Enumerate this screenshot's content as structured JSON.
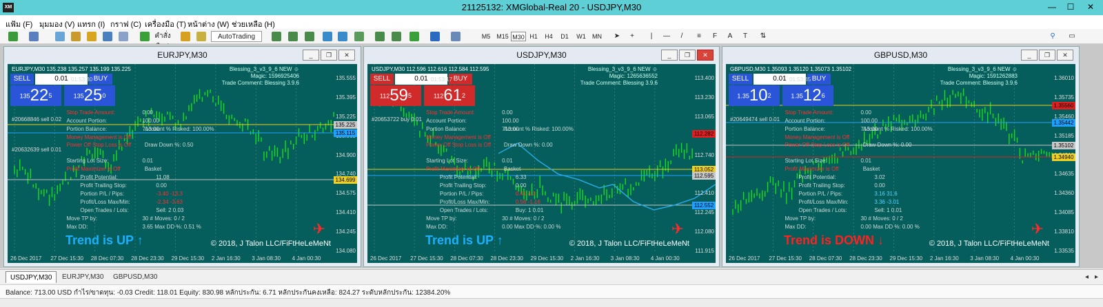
{
  "app": {
    "title": "21125132: XMGlobal-Real 20 - USDJPY,M30",
    "logo": "XM"
  },
  "menu": [
    "แฟ้ม (F)",
    "มุมมอง (V)",
    "แทรก (I)",
    "กราฟ (C)",
    "เครื่องมือ (T)",
    "หน้าต่าง (W)",
    "ช่วยเหลือ (H)"
  ],
  "toolbar": {
    "new_order_label": "คำสั่งใหม่",
    "autotrading_label": "AutoTrading",
    "timeframes": [
      "M5",
      "M15",
      "M30",
      "H1",
      "H4",
      "D1",
      "W1",
      "MN"
    ]
  },
  "charts": [
    {
      "title": "EURJPY,M30",
      "header": "EURJPY,M30  135.238 135.257 135.199 135.225",
      "ea_name": "Blessing_3_v3_9_6 NEW ☺",
      "magic": "Magic: 1596925406",
      "comment": "Trade Comment: Blessing 3.9.6",
      "lot": "0.01",
      "time": "01:53:30",
      "sell_big": "22",
      "sell_small": "135",
      "sell_sup": "5",
      "buy_big": "25",
      "buy_small": "135",
      "buy_sup": "0",
      "sell_label": "SELL",
      "buy_label": "BUY",
      "prices": [
        "135.555",
        "135.395",
        "135.225",
        "135.065",
        "134.900",
        "134.740",
        "134.575",
        "134.410",
        "134.245",
        "134.080"
      ],
      "price_tags": [
        {
          "text": "135.225",
          "color": "#c8c8c8"
        },
        {
          "text": "135.115",
          "color": "#1ea0ff"
        },
        {
          "text": "134.699",
          "color": "#f0d020"
        }
      ],
      "times": [
        "26 Dec 2017",
        "27 Dec 15:30",
        "28 Dec 07:30",
        "28 Dec 23:30",
        "29 Dec 15:30",
        "2 Jan 16:30",
        "3 Jan 08:30",
        "4 Jan 00:30"
      ],
      "order_lines": [
        "#20668846 sell 0.02",
        "#20632639 sell 0.01"
      ],
      "trend_text": "Trend is UP ↑",
      "trend_color": "#18b0ff",
      "copyright": "© 2018, J Talon LLC/FiFtHeLeMeNt",
      "stats": {
        "stop_amount": "0.00",
        "portion": "100.00",
        "account_portion": "100.00",
        "portion_balance": "713.00",
        "account_risked": "100.00%",
        "mm": "Money Management is Off",
        "power_off": "Power Off Stop Loss is Off",
        "drawdown": "0.50",
        "lot_size": "0.01",
        "pm": "Profit Maximizer is Off",
        "basket_label": "Basket",
        "profit_potential": "11.08",
        "trailing_stop": "0.00",
        "pl_pips": "-3.40",
        "pl_pips2": "-13.3",
        "maxmin": "-2.34",
        "maxmin2": "-3.63",
        "open_trades": "Sell:",
        "sell_count": "2",
        "sell_lots": "0.03",
        "move_tp": "30",
        "moves": "0 / 2",
        "max_dd": "3.65",
        "max_dd_pct": "0.51 %"
      }
    },
    {
      "title": "USDJPY,M30",
      "header": "USDJPY,M30  112.596 112.616 112.584 112.595",
      "ea_name": "Blessing_3_v3_9_6 NEW ☺",
      "magic": "Magic: 1265636552",
      "comment": "Trade Comment: Blessing 3.9.6",
      "lot": "0.01",
      "time": "01:53:17",
      "sell_big": "59",
      "sell_small": "112",
      "sell_sup": "5",
      "buy_big": "61",
      "buy_small": "112",
      "buy_sup": "2",
      "sell_label": "SELL",
      "buy_label": "BUY",
      "prices": [
        "113.400",
        "113.230",
        "113.065",
        "112.900",
        "112.740",
        "112.570",
        "112.410",
        "112.245",
        "112.080",
        "111.915"
      ],
      "price_tags": [
        {
          "text": "113.052",
          "color": "#f0d020"
        },
        {
          "text": "112.595",
          "color": "#c8c8c8"
        },
        {
          "text": "112.552",
          "color": "#1ea0ff"
        },
        {
          "text": "112.282",
          "color": "#e02020"
        }
      ],
      "times": [
        "26 Dec 2017",
        "27 Dec 15:30",
        "28 Dec 07:30",
        "28 Dec 23:30",
        "29 Dec 15:30",
        "2 Jan 16:30",
        "3 Jan 08:30",
        "4 Jan 00:30"
      ],
      "order_lines": [
        "#20653722 buy 0.01"
      ],
      "trend_text": "Trend is UP ↑",
      "trend_color": "#18b0ff",
      "copyright": "© 2018, J Talon LLC/FiFtHeLeMeNt",
      "stats": {
        "stop_amount": "0.00",
        "portion": "100.00",
        "account_portion": "100.00",
        "portion_balance": "713.00",
        "account_risked": "100.00%",
        "mm": "Money Management is Off",
        "power_off": "Power Off Stop Loss is Off",
        "drawdown": "0.00",
        "lot_size": "0.01",
        "pm": "Profit Maximizer is Off",
        "basket_label": "Basket",
        "profit_potential": "6.33",
        "trailing_stop": "0.00",
        "pl_pips": "0.41",
        "pl_pips2": "4.3",
        "maxmin": "0.56",
        "maxmin2": "-1.16",
        "open_trades": "Buy:",
        "sell_count": "1",
        "sell_lots": "0.01",
        "move_tp": "30",
        "moves": "0 / 2",
        "max_dd": "0.00",
        "max_dd_pct": "0.00 %"
      }
    },
    {
      "title": "GBPUSD,M30",
      "header": "GBPUSD,M30  1.35093 1.35120 1.35073 1.35102",
      "ea_name": "Blessing_3_v3_9_6 NEW ☺",
      "magic": "Magic: 1591262883",
      "comment": "Trade Comment: Blessing 3.9.6",
      "lot": "0.01",
      "time": "01:53:35",
      "sell_big": "10",
      "sell_small": "1.35",
      "sell_sup": "2",
      "buy_big": "12",
      "buy_small": "1.35",
      "buy_sup": "6",
      "sell_label": "SELL",
      "buy_label": "BUY",
      "prices": [
        "1.36010",
        "1.35735",
        "1.35460",
        "1.35185",
        "1.34910",
        "1.34635",
        "1.34360",
        "1.34085",
        "1.33810",
        "1.33535"
      ],
      "price_tags": [
        {
          "text": "1.35560",
          "color": "#e02020"
        },
        {
          "text": "1.35442",
          "color": "#1ea0ff"
        },
        {
          "text": "1.35102",
          "color": "#c8c8c8"
        },
        {
          "text": "1.34940",
          "color": "#f0d020"
        }
      ],
      "times": [
        "26 Dec 2017",
        "27 Dec 15:30",
        "28 Dec 07:30",
        "28 Dec 23:30",
        "29 Dec 15:30",
        "2 Jan 16:30",
        "3 Jan 08:30",
        "4 Jan 00:30"
      ],
      "order_lines": [
        "#20649474 sell 0.01"
      ],
      "trend_text": "Trend is DOWN ↓",
      "trend_color": "#ff2020",
      "copyright": "© 2018, J Talon LLC/FiFtHeLeMeNt",
      "stats": {
        "stop_amount": "0.00",
        "portion": "100.00",
        "account_portion": "100.00",
        "portion_balance": "713.00",
        "account_risked": "100.00%",
        "mm": "Money Management is Off",
        "power_off": "Power Off Stop Loss is Off",
        "drawdown": "0.00",
        "lot_size": "0.01",
        "pm": "Profit Maximizer is Off",
        "basket_label": "Basket",
        "profit_potential": "3.02",
        "trailing_stop": "0.00",
        "pl_pips": "3.16",
        "pl_pips2": "31.6",
        "maxmin": "3.36",
        "maxmin2": "-3.01",
        "open_trades": "Sell:",
        "sell_count": "1",
        "sell_lots": "0.01",
        "move_tp": "30",
        "moves": "0 / 2",
        "max_dd": "0.00",
        "max_dd_pct": "0.00 %"
      }
    }
  ],
  "labels": {
    "stop_amount": "Stop Trade Amount:",
    "portion": "Portion:",
    "account_portion": "Account Portion:",
    "portion_balance": "Portion Balance:",
    "account_risked": "Account % Risked:",
    "drawdown": "Draw Down %:",
    "lot_size": "Starting Lot Size:",
    "profit_potential": "Profit Potential:",
    "trailing_stop": "Profit Trailing Stop:",
    "pl_pips": "Portion P/L / Pips:",
    "maxmin": "Profit/Loss Max/Min:",
    "open_trades": "Open Trades / Lots:",
    "move_tp": "Move TP by:",
    "moves": "# Moves:",
    "max_dd": "Max DD:",
    "max_dd_pct": "Max DD %:"
  },
  "tabs": [
    "USDJPY,M30",
    "EURJPY,M30",
    "GBPUSD,M30"
  ],
  "status": "Balance: 713.00 USD  กำไร/ขาดทุน: -0.03  Credit: 118.01  Equity: 830.98  หลักประกัน: 6.71  หลักประกันคงเหลือ: 824.27  ระดับหลักประกัน: 12384.20%"
}
